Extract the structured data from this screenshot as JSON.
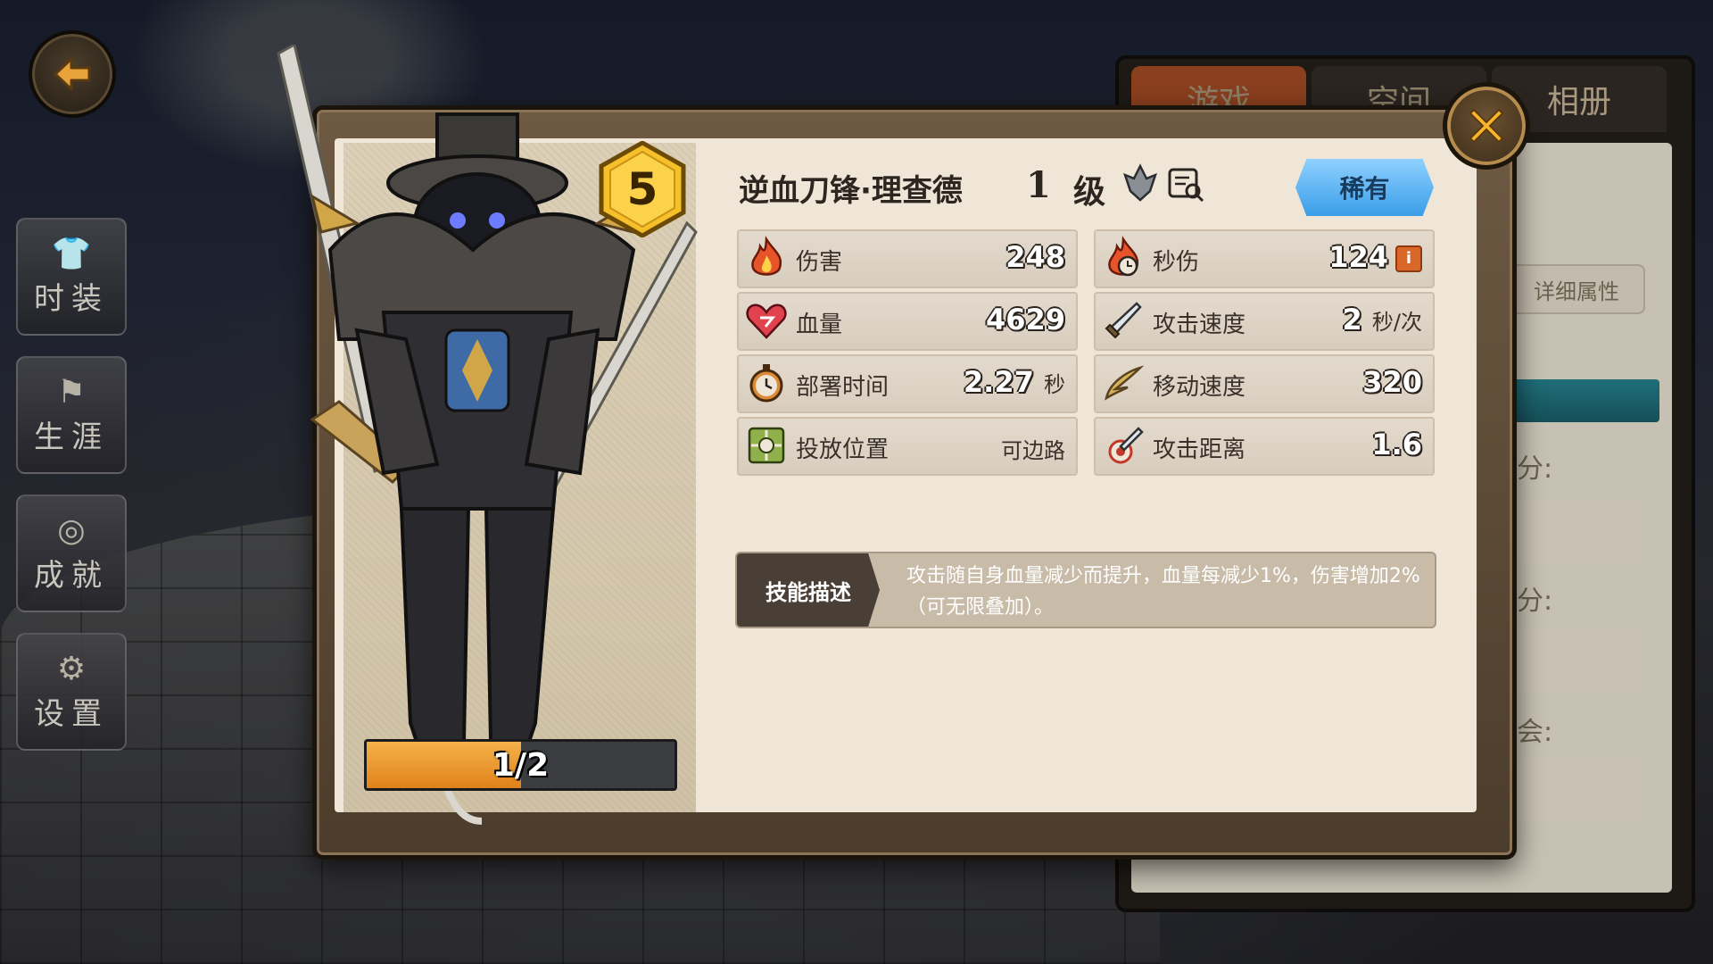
{
  "nav": {
    "side_menu": [
      {
        "label": "时装",
        "icon": "costume-icon"
      },
      {
        "label": "生涯",
        "icon": "career-flag-icon"
      },
      {
        "label": "成就",
        "icon": "achievement-medal-icon"
      },
      {
        "label": "设置",
        "icon": "settings-gear-icon"
      }
    ]
  },
  "background_panel": {
    "tabs": [
      "游戏",
      "空间",
      "相册"
    ],
    "detail_button": "详细属性",
    "labels": [
      "分:",
      "分:",
      "会:"
    ]
  },
  "card": {
    "hero_name": "逆血刀锋·理查德",
    "level_number": "1",
    "level_label": "级",
    "star_level": "5",
    "rarity": "稀有",
    "progress_text": "1/2",
    "progress_fraction": 0.5,
    "stats": [
      {
        "label": "伤害",
        "value": "248",
        "unit": "",
        "icon": "fire-icon"
      },
      {
        "label": "秒伤",
        "value": "124",
        "unit": "",
        "icon": "fire-clock-icon",
        "has_info": true,
        "info_glyph": "i"
      },
      {
        "label": "血量",
        "value": "4629",
        "unit": "",
        "icon": "heart-icon"
      },
      {
        "label": "攻击速度",
        "value": "2",
        "unit": "秒/次",
        "icon": "sword-icon"
      },
      {
        "label": "部署时间",
        "value": "2.27",
        "unit": "秒",
        "icon": "stopwatch-icon"
      },
      {
        "label": "移动速度",
        "value": "320",
        "unit": "",
        "icon": "wing-icon"
      },
      {
        "label": "投放位置",
        "value": "可边路",
        "unit": "",
        "icon": "deploy-position-icon",
        "plain": true
      },
      {
        "label": "攻击距离",
        "value": "1.6",
        "unit": "",
        "icon": "target-sword-icon"
      }
    ],
    "skill": {
      "tag": "技能描述",
      "text": "攻击随自身血量减少而提升，血量每减少1%，伤害增加2%（可无限叠加）。"
    }
  },
  "colors": {
    "rarity": "#3a9ee8",
    "progress": "#e0821b",
    "badge": "#f5c02a"
  }
}
